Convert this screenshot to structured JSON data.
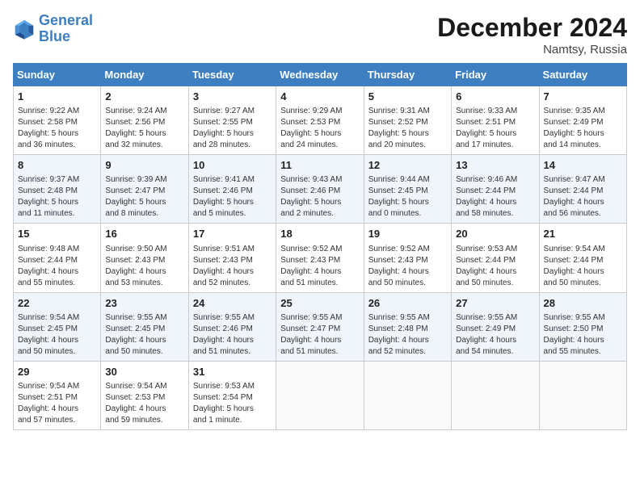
{
  "logo": {
    "line1": "General",
    "line2": "Blue"
  },
  "title": "December 2024",
  "location": "Namtsy, Russia",
  "weekdays": [
    "Sunday",
    "Monday",
    "Tuesday",
    "Wednesday",
    "Thursday",
    "Friday",
    "Saturday"
  ],
  "weeks": [
    [
      {
        "day": "1",
        "info": "Sunrise: 9:22 AM\nSunset: 2:58 PM\nDaylight: 5 hours\nand 36 minutes."
      },
      {
        "day": "2",
        "info": "Sunrise: 9:24 AM\nSunset: 2:56 PM\nDaylight: 5 hours\nand 32 minutes."
      },
      {
        "day": "3",
        "info": "Sunrise: 9:27 AM\nSunset: 2:55 PM\nDaylight: 5 hours\nand 28 minutes."
      },
      {
        "day": "4",
        "info": "Sunrise: 9:29 AM\nSunset: 2:53 PM\nDaylight: 5 hours\nand 24 minutes."
      },
      {
        "day": "5",
        "info": "Sunrise: 9:31 AM\nSunset: 2:52 PM\nDaylight: 5 hours\nand 20 minutes."
      },
      {
        "day": "6",
        "info": "Sunrise: 9:33 AM\nSunset: 2:51 PM\nDaylight: 5 hours\nand 17 minutes."
      },
      {
        "day": "7",
        "info": "Sunrise: 9:35 AM\nSunset: 2:49 PM\nDaylight: 5 hours\nand 14 minutes."
      }
    ],
    [
      {
        "day": "8",
        "info": "Sunrise: 9:37 AM\nSunset: 2:48 PM\nDaylight: 5 hours\nand 11 minutes."
      },
      {
        "day": "9",
        "info": "Sunrise: 9:39 AM\nSunset: 2:47 PM\nDaylight: 5 hours\nand 8 minutes."
      },
      {
        "day": "10",
        "info": "Sunrise: 9:41 AM\nSunset: 2:46 PM\nDaylight: 5 hours\nand 5 minutes."
      },
      {
        "day": "11",
        "info": "Sunrise: 9:43 AM\nSunset: 2:46 PM\nDaylight: 5 hours\nand 2 minutes."
      },
      {
        "day": "12",
        "info": "Sunrise: 9:44 AM\nSunset: 2:45 PM\nDaylight: 5 hours\nand 0 minutes."
      },
      {
        "day": "13",
        "info": "Sunrise: 9:46 AM\nSunset: 2:44 PM\nDaylight: 4 hours\nand 58 minutes."
      },
      {
        "day": "14",
        "info": "Sunrise: 9:47 AM\nSunset: 2:44 PM\nDaylight: 4 hours\nand 56 minutes."
      }
    ],
    [
      {
        "day": "15",
        "info": "Sunrise: 9:48 AM\nSunset: 2:44 PM\nDaylight: 4 hours\nand 55 minutes."
      },
      {
        "day": "16",
        "info": "Sunrise: 9:50 AM\nSunset: 2:43 PM\nDaylight: 4 hours\nand 53 minutes."
      },
      {
        "day": "17",
        "info": "Sunrise: 9:51 AM\nSunset: 2:43 PM\nDaylight: 4 hours\nand 52 minutes."
      },
      {
        "day": "18",
        "info": "Sunrise: 9:52 AM\nSunset: 2:43 PM\nDaylight: 4 hours\nand 51 minutes."
      },
      {
        "day": "19",
        "info": "Sunrise: 9:52 AM\nSunset: 2:43 PM\nDaylight: 4 hours\nand 50 minutes."
      },
      {
        "day": "20",
        "info": "Sunrise: 9:53 AM\nSunset: 2:44 PM\nDaylight: 4 hours\nand 50 minutes."
      },
      {
        "day": "21",
        "info": "Sunrise: 9:54 AM\nSunset: 2:44 PM\nDaylight: 4 hours\nand 50 minutes."
      }
    ],
    [
      {
        "day": "22",
        "info": "Sunrise: 9:54 AM\nSunset: 2:45 PM\nDaylight: 4 hours\nand 50 minutes."
      },
      {
        "day": "23",
        "info": "Sunrise: 9:55 AM\nSunset: 2:45 PM\nDaylight: 4 hours\nand 50 minutes."
      },
      {
        "day": "24",
        "info": "Sunrise: 9:55 AM\nSunset: 2:46 PM\nDaylight: 4 hours\nand 51 minutes."
      },
      {
        "day": "25",
        "info": "Sunrise: 9:55 AM\nSunset: 2:47 PM\nDaylight: 4 hours\nand 51 minutes."
      },
      {
        "day": "26",
        "info": "Sunrise: 9:55 AM\nSunset: 2:48 PM\nDaylight: 4 hours\nand 52 minutes."
      },
      {
        "day": "27",
        "info": "Sunrise: 9:55 AM\nSunset: 2:49 PM\nDaylight: 4 hours\nand 54 minutes."
      },
      {
        "day": "28",
        "info": "Sunrise: 9:55 AM\nSunset: 2:50 PM\nDaylight: 4 hours\nand 55 minutes."
      }
    ],
    [
      {
        "day": "29",
        "info": "Sunrise: 9:54 AM\nSunset: 2:51 PM\nDaylight: 4 hours\nand 57 minutes."
      },
      {
        "day": "30",
        "info": "Sunrise: 9:54 AM\nSunset: 2:53 PM\nDaylight: 4 hours\nand 59 minutes."
      },
      {
        "day": "31",
        "info": "Sunrise: 9:53 AM\nSunset: 2:54 PM\nDaylight: 5 hours\nand 1 minute."
      },
      {
        "day": "",
        "info": ""
      },
      {
        "day": "",
        "info": ""
      },
      {
        "day": "",
        "info": ""
      },
      {
        "day": "",
        "info": ""
      }
    ]
  ]
}
